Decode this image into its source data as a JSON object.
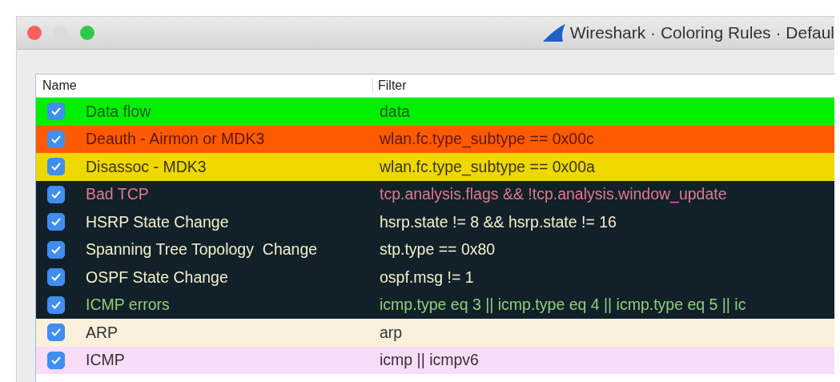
{
  "window": {
    "title": "Wireshark · Coloring Rules · Defaul"
  },
  "table": {
    "columns": [
      "Name",
      "Filter"
    ],
    "rows": [
      {
        "checked": true,
        "name": "Data flow",
        "filter": "data",
        "color": "#00f000",
        "foreground": {
          "color": "#1a5a1a"
        }
      },
      {
        "checked": true,
        "name": "Deauth - Airmon or MDK3",
        "filter": "wlan.fc.type_subtype == 0x00c",
        "color": "#ff5a00",
        "foreground": {
          "color": "#5a1a0a"
        }
      },
      {
        "checked": true,
        "name": "Disassoc - MDK3",
        "filter": "wlan.fc.type_subtype == 0x00a",
        "color": "#eed800",
        "foreground": {
          "color": "#3a3510"
        }
      },
      {
        "checked": true,
        "name": "Bad TCP",
        "filter": "tcp.analysis.flags && !tcp.analysis.window_update",
        "color": "#12202a",
        "foreground": {
          "color": "#e07a8a"
        }
      },
      {
        "checked": true,
        "name": "HSRP State Change",
        "filter": "hsrp.state != 8 && hsrp.state != 16",
        "color": "#12202a",
        "foreground": {
          "color": "#f2f0c8"
        }
      },
      {
        "checked": true,
        "name": "Spanning Tree Topology  Change",
        "filter": "stp.type == 0x80",
        "color": "#12202a",
        "foreground": {
          "color": "#f2f0c8"
        }
      },
      {
        "checked": true,
        "name": "OSPF State Change",
        "filter": "ospf.msg != 1",
        "color": "#12202a",
        "foreground": {
          "color": "#f2f0c8"
        }
      },
      {
        "checked": true,
        "name": "ICMP errors",
        "filter": "icmp.type eq 3 || icmp.type eq 4 || icmp.type eq 5 || ic",
        "color": "#12202a",
        "foreground": {
          "color": "#8ed07a"
        }
      },
      {
        "checked": true,
        "name": "ARP",
        "filter": "arp",
        "color": "#faf0dc",
        "foreground": {
          "color": "#333333"
        }
      },
      {
        "checked": true,
        "name": "ICMP",
        "filter": "icmp || icmpv6",
        "color": "#f8dcf8",
        "foreground": {
          "color": "#333333"
        }
      }
    ]
  }
}
